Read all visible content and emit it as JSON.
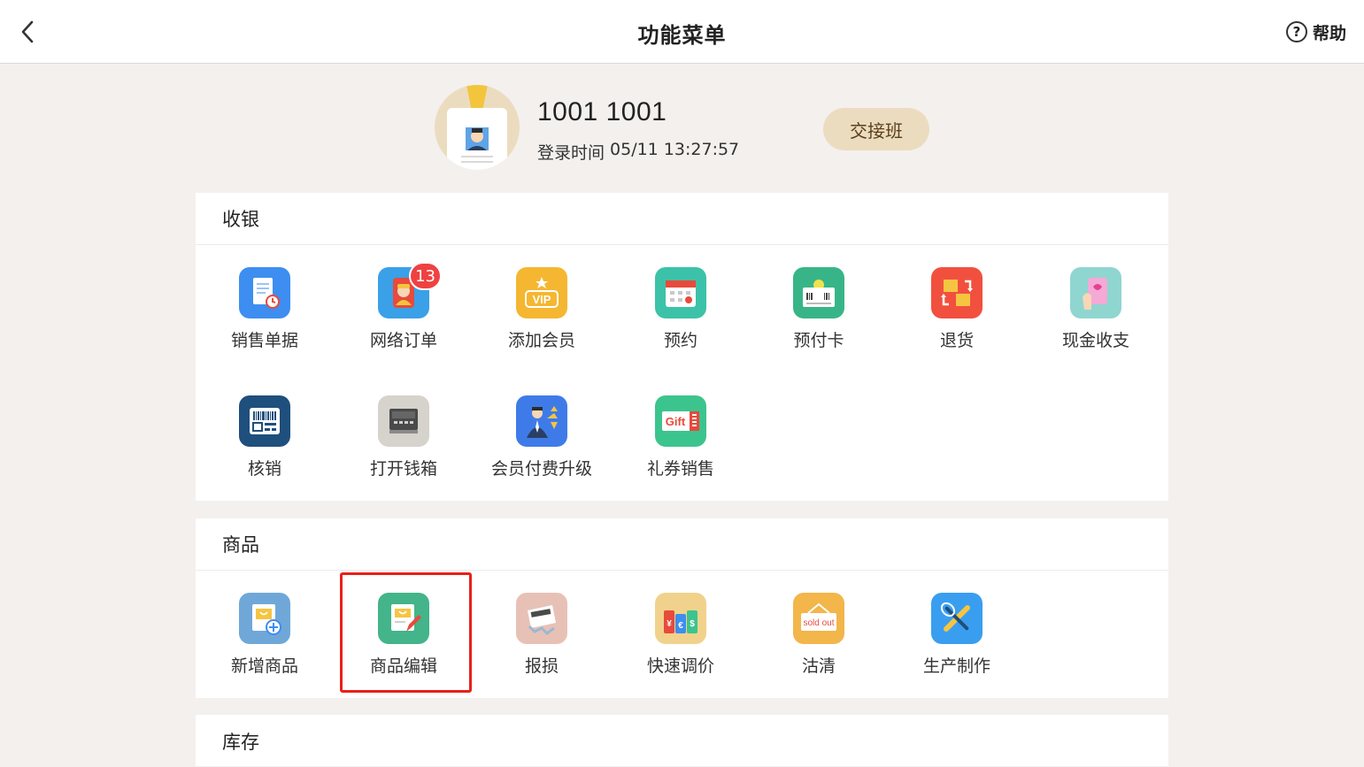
{
  "header": {
    "title": "功能菜单",
    "help_label": "帮助"
  },
  "profile": {
    "name": "1001 1001",
    "login_label": "登录时间",
    "login_time": "05/11 13:27:57",
    "shift_button": "交接班"
  },
  "sections": [
    {
      "title": "收银",
      "items": [
        {
          "label": "销售单据",
          "icon": "sales-receipt-icon",
          "color": "#3d8ef0"
        },
        {
          "label": "网络订单",
          "icon": "online-order-icon",
          "color": "#3aa0e8",
          "badge": "13"
        },
        {
          "label": "添加会员",
          "icon": "vip-icon",
          "color": "#f5b731",
          "text": "VIP"
        },
        {
          "label": "预约",
          "icon": "calendar-icon",
          "color": "#3cc2a8"
        },
        {
          "label": "预付卡",
          "icon": "prepaid-card-icon",
          "color": "#38b588"
        },
        {
          "label": "退货",
          "icon": "return-goods-icon",
          "color": "#f2503f"
        },
        {
          "label": "现金收支",
          "icon": "cash-card-icon",
          "color": "#8fd6d0"
        },
        {
          "label": "核销",
          "icon": "barcode-scan-icon",
          "color": "#1f4f7c"
        },
        {
          "label": "打开钱箱",
          "icon": "cash-drawer-icon",
          "color": "#d6d2cc"
        },
        {
          "label": "会员付费升级",
          "icon": "member-upgrade-icon",
          "color": "#3f7be8"
        },
        {
          "label": "礼券销售",
          "icon": "gift-voucher-icon",
          "color": "#3cc48e",
          "text": "Gift"
        }
      ]
    },
    {
      "title": "商品",
      "items": [
        {
          "label": "新增商品",
          "icon": "add-product-icon",
          "color": "#6fa8d8"
        },
        {
          "label": "商品编辑",
          "icon": "edit-product-icon",
          "color": "#44b48a"
        },
        {
          "label": "报损",
          "icon": "damage-report-icon",
          "color": "#e8c1b6"
        },
        {
          "label": "快速调价",
          "icon": "price-tags-icon",
          "color": "#f1d28c"
        },
        {
          "label": "沽清",
          "icon": "sold-out-icon",
          "color": "#f2b64a",
          "text": "sold out"
        },
        {
          "label": "生产制作",
          "icon": "production-tools-icon",
          "color": "#3a9ef0"
        }
      ]
    },
    {
      "title": "库存",
      "items": []
    }
  ]
}
